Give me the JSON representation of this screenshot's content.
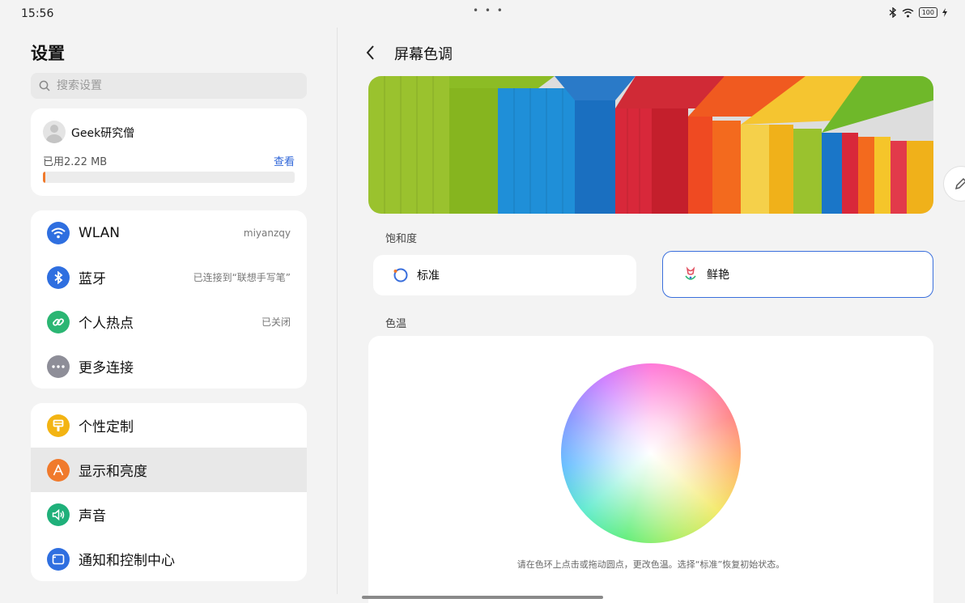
{
  "status": {
    "time": "15:56",
    "battery": "100"
  },
  "sidebar": {
    "title": "设置",
    "search_placeholder": "搜索设置",
    "account": {
      "name": "Geek研究僧",
      "storage": "已用2.22 MB",
      "view_label": "查看",
      "storage_fraction": 0.01
    },
    "connections": [
      {
        "label": "WLAN",
        "value": "miyanzqy",
        "icon": "wifi-icon",
        "color": "#2f6fe0"
      },
      {
        "label": "蓝牙",
        "value": "已连接到“联想手写笔”",
        "icon": "bluetooth-icon",
        "color": "#2f6fe0"
      },
      {
        "label": "个人热点",
        "value": "已关闭",
        "icon": "link-icon",
        "color": "#2bb673"
      },
      {
        "label": "更多连接",
        "value": "",
        "icon": "more-icon",
        "color": "#8e8e98"
      }
    ],
    "personal": [
      {
        "label": "个性定制",
        "icon": "brush-icon",
        "color": "#f3b413"
      },
      {
        "label": "显示和亮度",
        "icon": "display-icon",
        "color": "#f07a2c",
        "active": true
      },
      {
        "label": "声音",
        "icon": "sound-icon",
        "color": "#1fb07a"
      },
      {
        "label": "通知和控制中心",
        "icon": "notification-icon",
        "color": "#2f6fe0"
      }
    ]
  },
  "main": {
    "title": "屏幕色调",
    "saturation_label": "饱和度",
    "options": [
      {
        "label": "标准",
        "selected": false
      },
      {
        "label": "鲜艳",
        "selected": true
      }
    ],
    "temperature_label": "色温",
    "hint": "请在色环上点击或拖动圆点，更改色温。选择“标准”恢复初始状态。"
  }
}
